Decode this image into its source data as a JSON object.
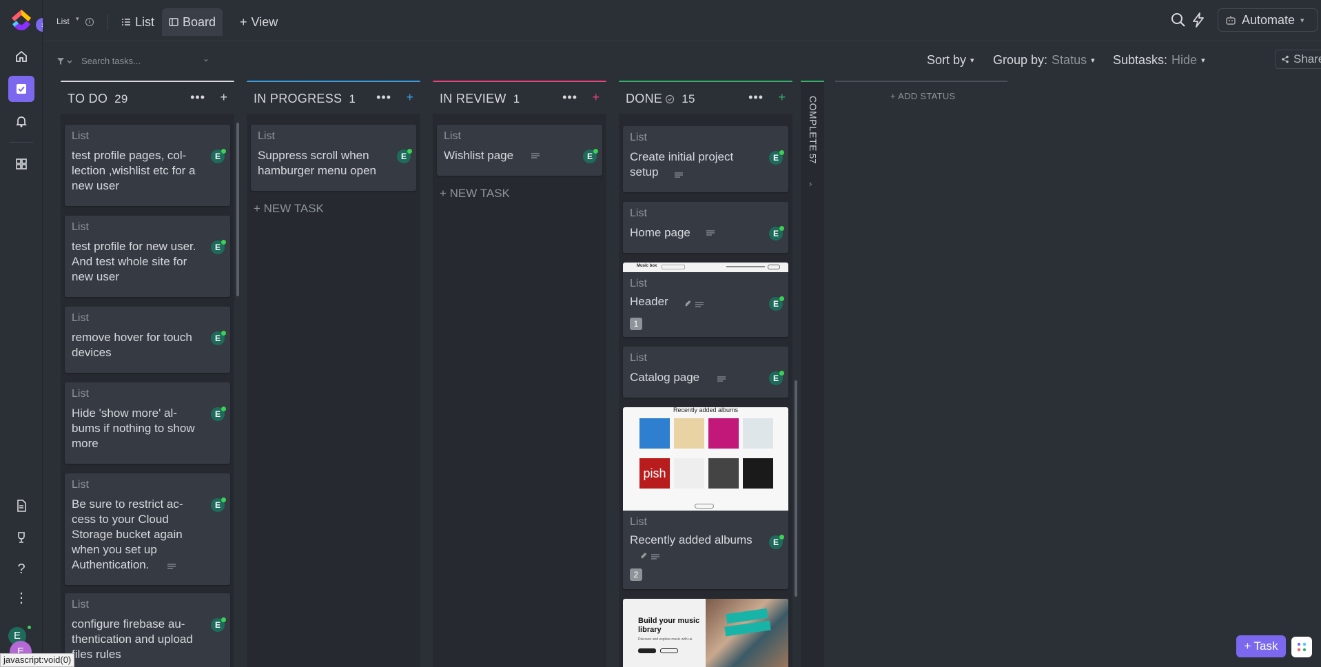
{
  "colors": {
    "accent": "#7b68ee",
    "todo": "#d7d9dd",
    "in_progress": "#3b9de2",
    "in_review": "#e8437a",
    "done": "#35b06b",
    "complete": "#35b06b"
  },
  "topbar": {
    "crumb": "List",
    "tabs": [
      {
        "label": "List",
        "icon": "list-icon"
      },
      {
        "label": "Board",
        "icon": "board-icon"
      },
      {
        "label": "View",
        "icon": "plus-icon"
      }
    ],
    "automate": "Automate"
  },
  "toolbar": {
    "search_placeholder": "Search tasks...",
    "sort_by": "Sort by",
    "group_by_label": "Group by:",
    "group_by_value": "Status",
    "subtasks_label": "Subtasks:",
    "subtasks_value": "Hide",
    "share": "Share"
  },
  "columns": {
    "todo": {
      "title": "TO DO",
      "count": "29",
      "cards": [
        {
          "list": "List",
          "title": "test profile pages, col-lection ,wishlist etc for a new user",
          "avatar": "E"
        },
        {
          "list": "List",
          "title": "test profile for new user. And test whole site for new user",
          "avatar": "E"
        },
        {
          "list": "List",
          "title": "remove hover for touch devices",
          "avatar": "E"
        },
        {
          "list": "List",
          "title": "Hide 'show more' al-bums if nothing to show more",
          "avatar": "E"
        },
        {
          "list": "List",
          "title": "Be sure to restrict ac-cess to your Cloud Storage bucket again when you set up Authentication.",
          "avatar": "E"
        },
        {
          "list": "List",
          "title": "configure firebase au-thentication and upload files rules",
          "avatar": "E"
        }
      ]
    },
    "in_progress": {
      "title": "IN PROGRESS",
      "count": "1",
      "cards": [
        {
          "list": "List",
          "title": "Suppress scroll when hamburger menu open",
          "avatar": "E"
        }
      ],
      "new_task": "+ NEW TASK"
    },
    "in_review": {
      "title": "IN REVIEW",
      "count": "1",
      "cards": [
        {
          "list": "List",
          "title": "Wishlist page",
          "avatar": "E"
        }
      ],
      "new_task": "+ NEW TASK"
    },
    "done": {
      "title": "DONE",
      "count": "15",
      "cards": [
        {
          "list": "List",
          "title": "Create initial project setup",
          "avatar": "E"
        },
        {
          "list": "List",
          "title": "Home page",
          "avatar": "E"
        },
        {
          "list": "List",
          "title": "Header",
          "avatar": "E",
          "badge": "1",
          "cover_text": "Music box"
        },
        {
          "list": "List",
          "title": "Catalog page",
          "avatar": "E"
        },
        {
          "list": "List",
          "title": "Recently added albums",
          "avatar": "E",
          "badge": "2",
          "cover_text": "Recently added albums"
        },
        {
          "cover_title": "Build your music library",
          "cover_sub": "Discover and explore music with us"
        }
      ]
    },
    "complete": {
      "title": "COMPLETE",
      "count": "57"
    }
  },
  "add_status": "+ ADD STATUS",
  "rail": {
    "avatar": "E"
  },
  "bottom": {
    "task_button": "Task",
    "status_url": "javascript:void(0)"
  }
}
